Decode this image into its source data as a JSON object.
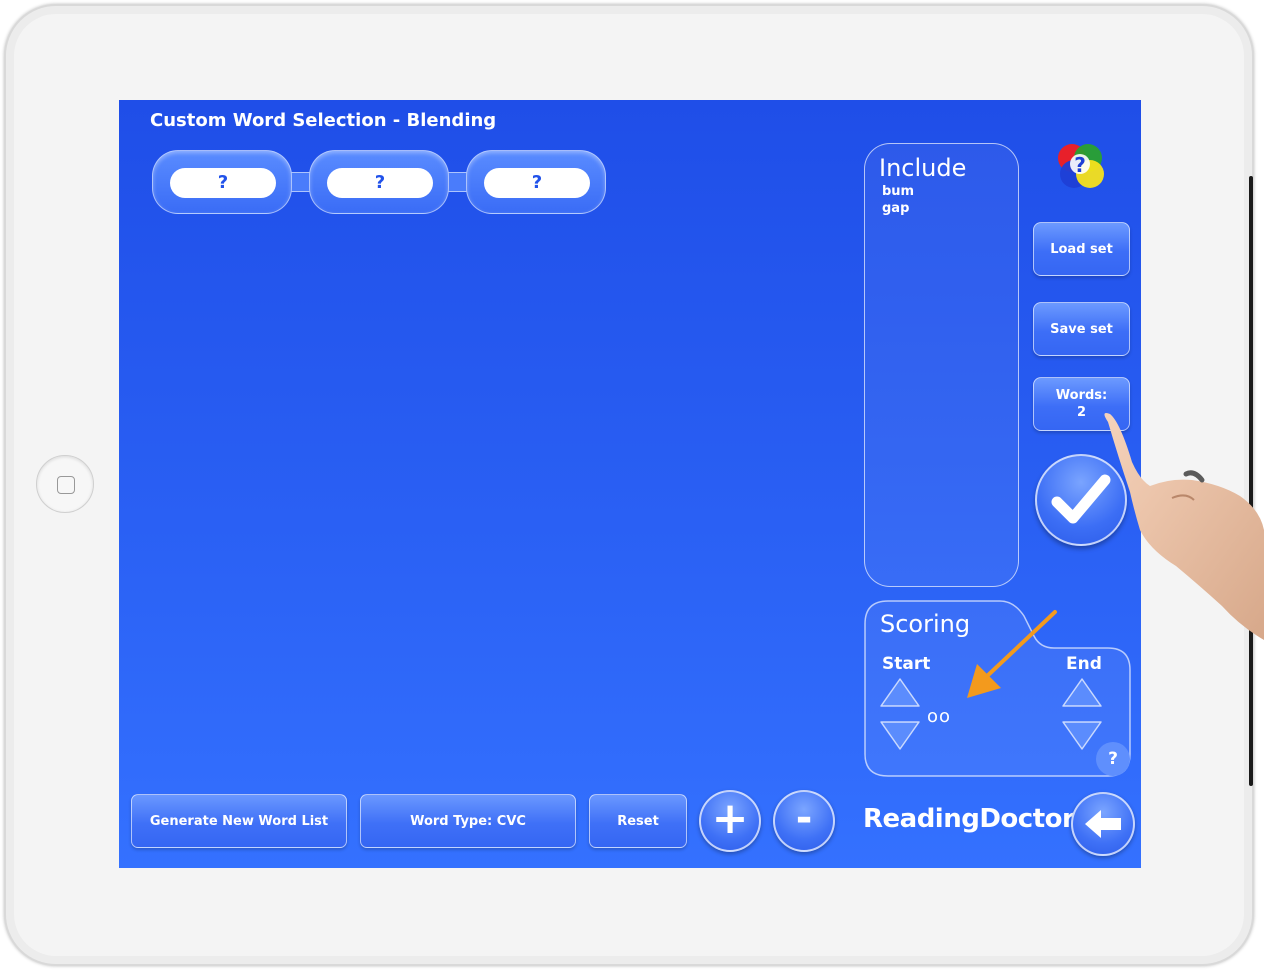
{
  "screen": {
    "title": "Custom Word Selection - Blending"
  },
  "slots": [
    "?",
    "?",
    "?"
  ],
  "include": {
    "title": "Include",
    "words": [
      "bum",
      "gap"
    ]
  },
  "side_buttons": {
    "load": "Load set",
    "save": "Save set",
    "words_label": "Words:",
    "words_count": "2"
  },
  "scoring": {
    "title": "Scoring",
    "start_label": "Start",
    "end_label": "End",
    "dots": "oo",
    "help": "?"
  },
  "bottom": {
    "generate": "Generate New Word List",
    "word_type": "Word Type: CVC",
    "reset": "Reset",
    "plus": "+",
    "minus": "-"
  },
  "logo": {
    "text_a": "Reading",
    "text_b": "Doctor"
  },
  "colors": {
    "screen_blue": "#2a60f4",
    "accent_orange": "#f39a1d"
  },
  "icons": [
    "help-color-circles-icon",
    "check-icon",
    "up-arrow-icon",
    "down-arrow-icon",
    "plus-icon",
    "minus-icon",
    "back-arrow-icon",
    "home-button-icon"
  ]
}
